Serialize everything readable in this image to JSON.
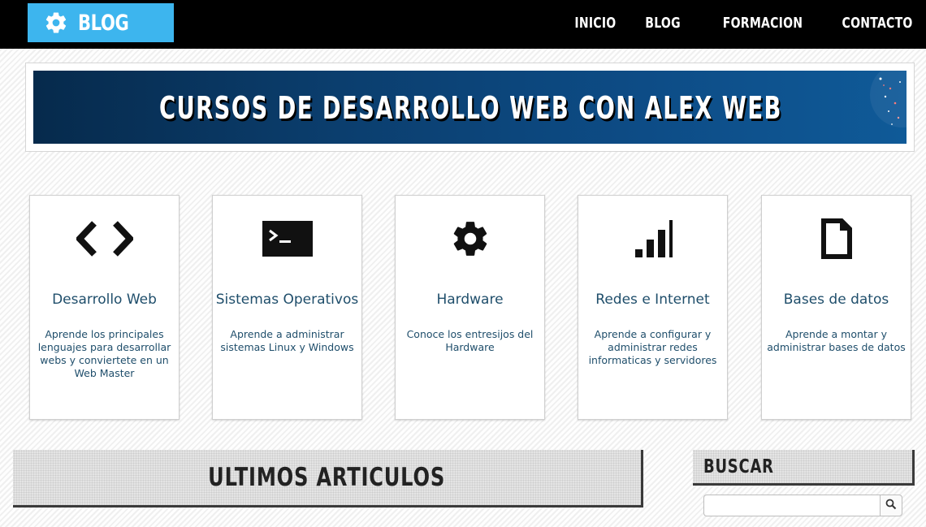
{
  "header": {
    "logo_text": "BLOG",
    "logo_icon": "gear-icon",
    "nav": [
      {
        "label": "INICIO"
      },
      {
        "label": "BLOG"
      },
      {
        "label": "FORMACION"
      },
      {
        "label": "CONTACTO"
      }
    ]
  },
  "banner": {
    "title": "CURSOS DE DESARROLLO WEB CON ALEX WEB"
  },
  "cards": [
    {
      "icon": "code-icon",
      "title": "Desarrollo Web",
      "description": "Aprende los principales lenguajes para desarrollar webs y conviertete en un Web Master"
    },
    {
      "icon": "terminal-icon",
      "title": "Sistemas Operativos",
      "description": "Aprende a administrar sistemas Linux y Windows"
    },
    {
      "icon": "gear-icon",
      "title": "Hardware",
      "description": "Conoce los entresijos del Hardware"
    },
    {
      "icon": "signal-bars-icon",
      "title": "Redes e Internet",
      "description": "Aprende a configurar y administrar redes informaticas y servidores"
    },
    {
      "icon": "file-icon",
      "title": "Bases de datos",
      "description": "Aprende a montar y administrar bases de datos"
    }
  ],
  "articles": {
    "title": "ULTIMOS ARTICULOS"
  },
  "search": {
    "title": "BUSCAR",
    "value": "",
    "icon": "search-icon"
  },
  "colors": {
    "topbar": "#000000",
    "logo_bg": "#3db5ee",
    "card_text": "#1f4e6b",
    "banner": "#0b3e6e"
  }
}
